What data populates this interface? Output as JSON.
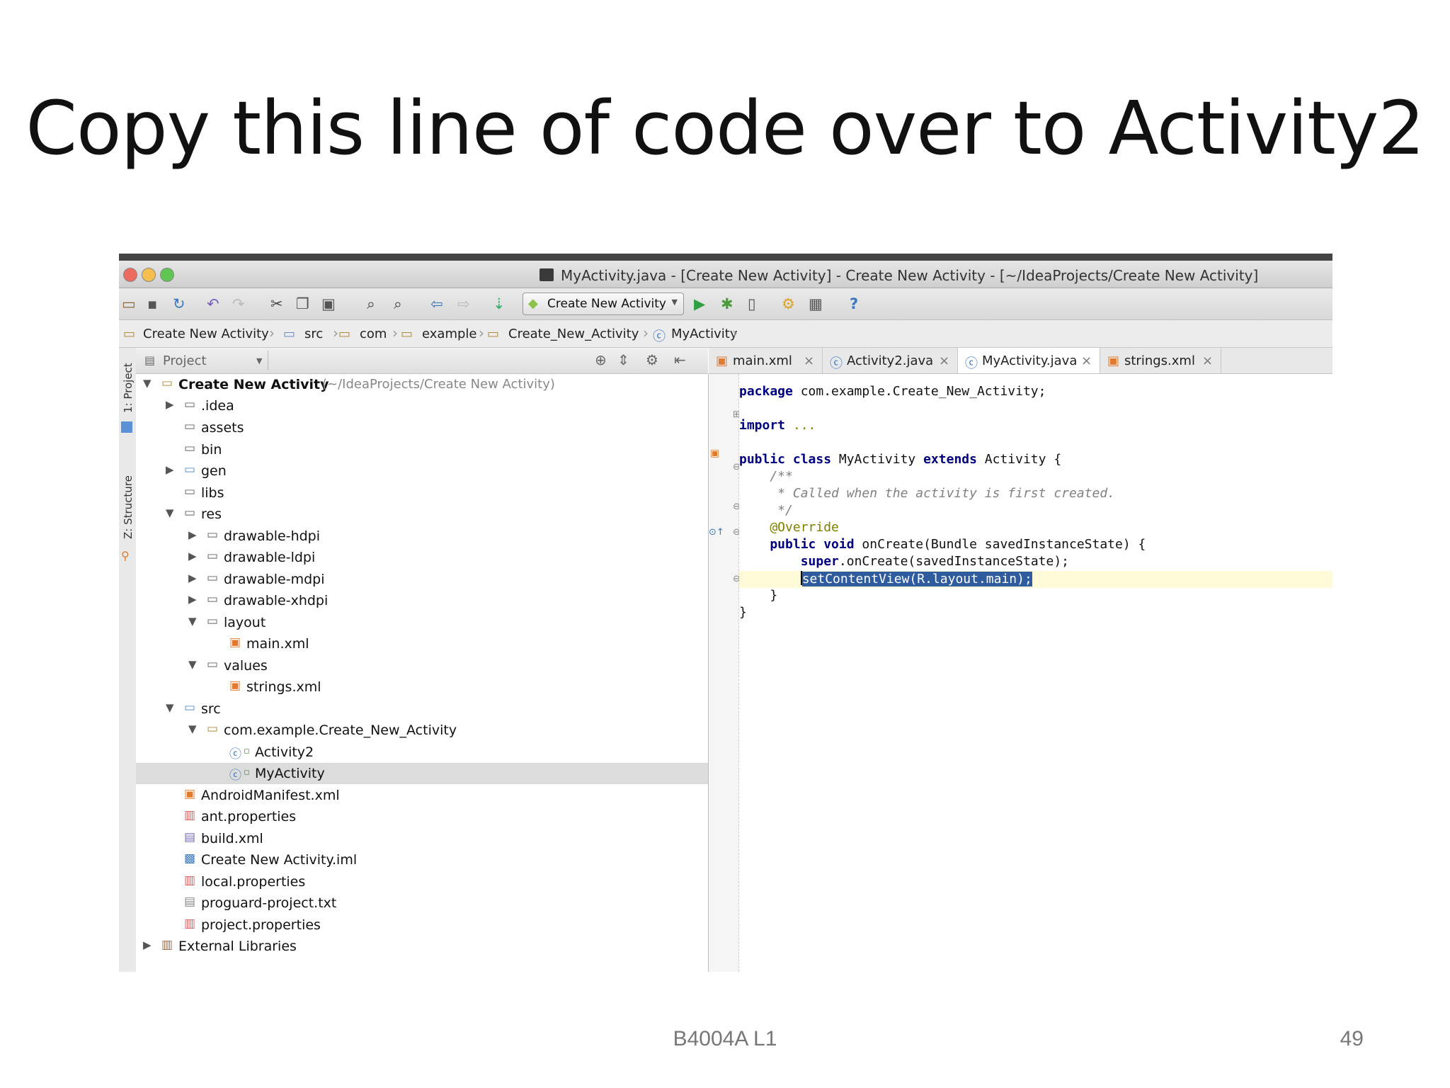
{
  "slide": {
    "title": "Copy this line of code over to Activity2",
    "footer": "B4004A L1",
    "page_number": "49"
  },
  "window": {
    "title": "MyActivity.java - [Create New Activity] - Create New Activity - [~/IdeaProjects/Create New Activity]"
  },
  "toolbar": {
    "run_config": "Create New Activity",
    "help_label": "?"
  },
  "breadcrumb": [
    "Create New Activity",
    "src",
    "com",
    "example",
    "Create_New_Activity",
    "MyActivity"
  ],
  "side_tabs": {
    "project": "1: Project",
    "structure": "Z: Structure"
  },
  "project_panel": {
    "view_selector": "Project"
  },
  "tree": {
    "root_label": "Create New Activity",
    "root_path": "(~/IdeaProjects/Create New Activity)",
    "items": [
      ".idea",
      "assets",
      "bin",
      "gen",
      "libs",
      "res",
      "drawable-hdpi",
      "drawable-ldpi",
      "drawable-mdpi",
      "drawable-xhdpi",
      "layout",
      "main.xml",
      "values",
      "strings.xml",
      "src",
      "com.example.Create_New_Activity",
      "Activity2",
      "MyActivity",
      "AndroidManifest.xml",
      "ant.properties",
      "build.xml",
      "Create New Activity.iml",
      "local.properties",
      "proguard-project.txt",
      "project.properties",
      "External Libraries"
    ]
  },
  "editor": {
    "tabs": [
      "main.xml",
      "Activity2.java",
      "MyActivity.java",
      "strings.xml"
    ],
    "active_tab": "MyActivity.java",
    "code": {
      "package_kw": "package",
      "package_name": " com.example.Create_New_Activity;",
      "import_kw": "import",
      "import_rest": " ...",
      "class_kw1": "public class",
      "class_name": " MyActivity ",
      "class_kw2": "extends",
      "class_rest": " Activity {",
      "doc_open": "    /**",
      "doc_body": "     * Called when the activity is first created.",
      "doc_close": "     */",
      "override": "    @Override",
      "method_kw": "    public void",
      "method_rest": " onCreate(Bundle savedInstanceState) {",
      "super_kw": "        super",
      "super_rest": ".onCreate(savedInstanceState);",
      "indent": "        ",
      "selected_code": "setContentView(R.layout.main);",
      "method_close": "    }",
      "class_close": "}"
    }
  }
}
